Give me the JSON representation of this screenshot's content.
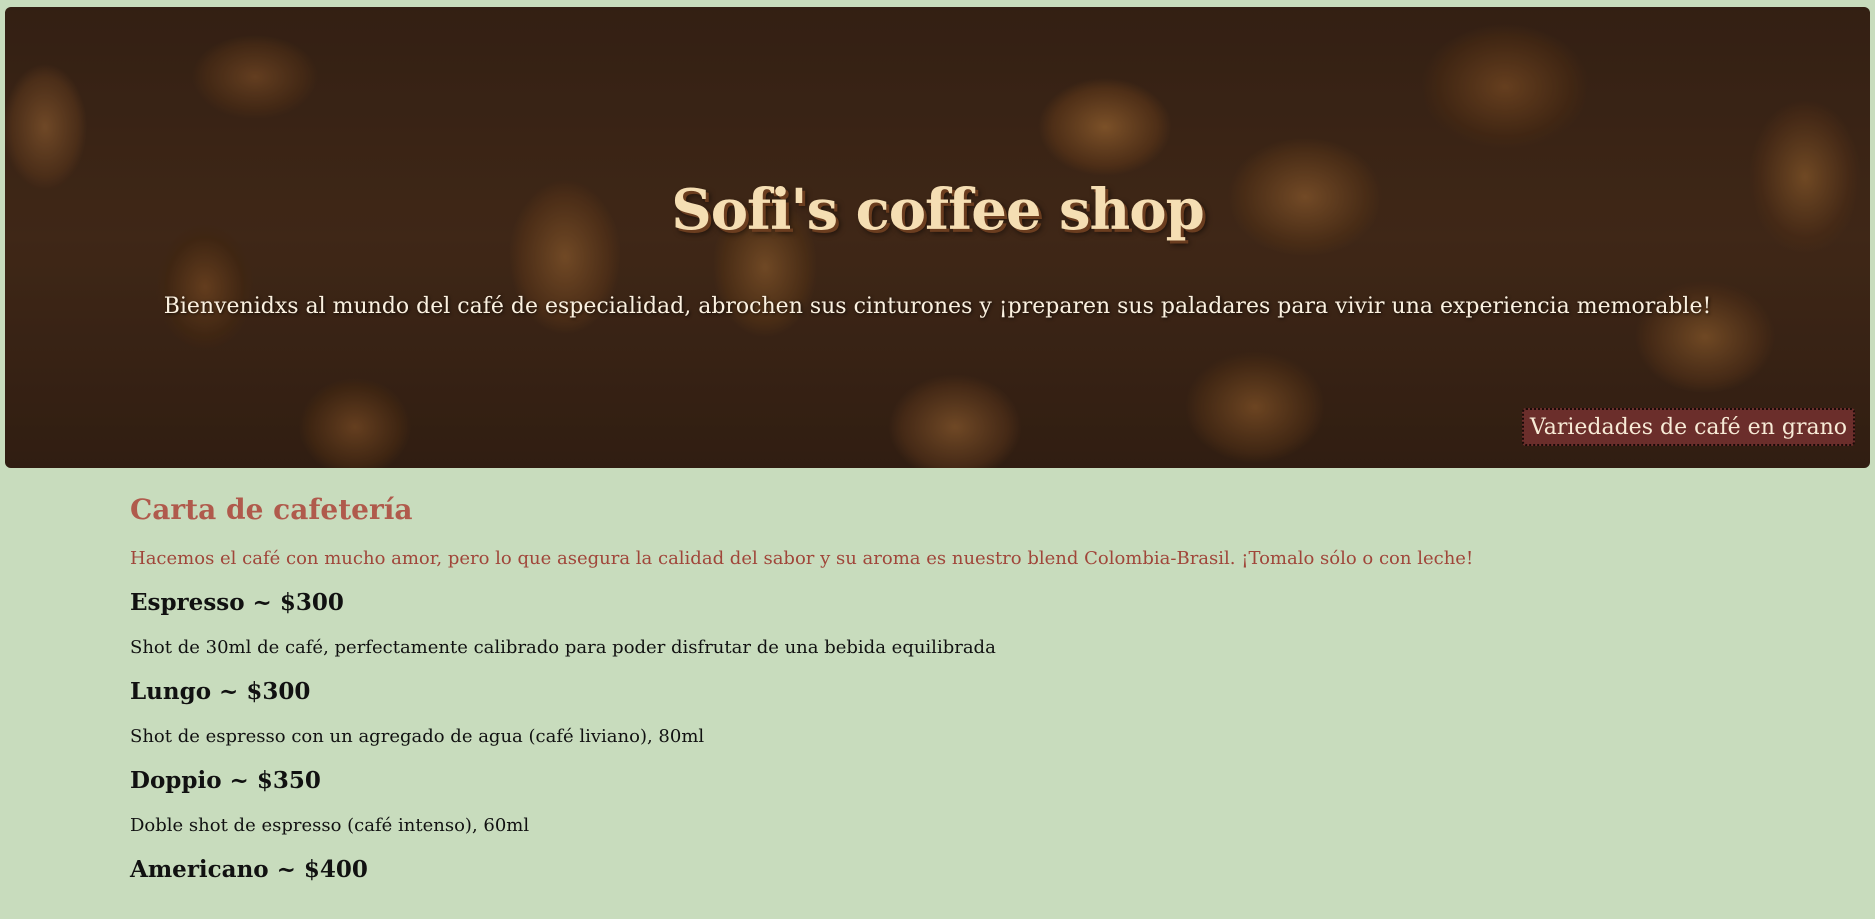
{
  "hero": {
    "title": "Sofi's coffee shop",
    "subtitle": "Bienvenidxs al mundo del café de especialidad, abrochen sus cinturones y ¡preparen sus paladares para vivir una experiencia memorable!",
    "button_label": "Variedades de café en grano"
  },
  "menu": {
    "title": "Carta de cafetería",
    "intro": "Hacemos el café con mucho amor, pero lo que asegura la calidad del sabor y su aroma es nuestro blend Colombia-Brasil. ¡Tomalo sólo o con leche!",
    "items": [
      {
        "name": "Espresso ~ $300",
        "description": "Shot de 30ml de café, perfectamente calibrado para poder disfrutar de una bebida equilibrada"
      },
      {
        "name": "Lungo ~ $300",
        "description": "Shot de espresso con un agregado de agua (café liviano), 80ml"
      },
      {
        "name": "Doppio ~ $350",
        "description": "Doble shot de espresso (café intenso), 60ml"
      },
      {
        "name": "Americano ~ $400",
        "description": ""
      }
    ]
  },
  "colors": {
    "background": "#c8dcbd",
    "title": "#f5deb3",
    "section_title": "#b05a4c",
    "button_bg": "#6b2e2b"
  }
}
